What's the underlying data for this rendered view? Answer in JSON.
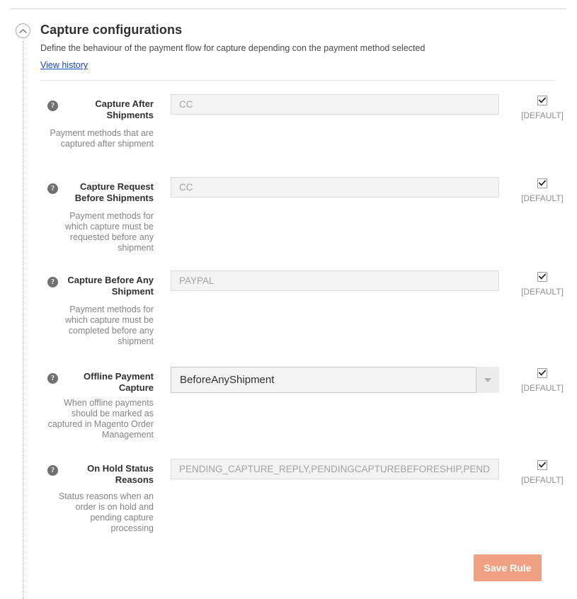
{
  "section": {
    "title": "Capture configurations",
    "description": "Define the behaviour of the payment flow for capture depending con the payment method selected",
    "history_link": "View history",
    "collapse_icon": "chevron-up-circle-icon",
    "help_icon": "question-mark-icon"
  },
  "fields": [
    {
      "label": "Capture After Shipments",
      "note": "Payment methods that are captured after shipment",
      "control": "text",
      "value": "",
      "placeholder": "CC",
      "scope_checked": true,
      "scope_label": "[DEFAULT]"
    },
    {
      "label": "Capture Request Before Shipments",
      "note": "Payment methods for which capture must be requested before any shipment",
      "control": "text",
      "value": "",
      "placeholder": "CC",
      "scope_checked": true,
      "scope_label": "[DEFAULT]"
    },
    {
      "label": "Capture Before Any Shipment",
      "note": "Payment methods for which capture must be completed before any shipment",
      "control": "text",
      "value": "",
      "placeholder": "PAYPAL",
      "scope_checked": true,
      "scope_label": "[DEFAULT]"
    },
    {
      "label": "Offline Payment Capture",
      "note": "When offline payments should be marked as captured in Magento Order Management",
      "control": "select",
      "value": "BeforeAnyShipment",
      "placeholder": "",
      "scope_checked": true,
      "scope_label": "[DEFAULT]"
    },
    {
      "label": "On Hold Status Reasons",
      "note": "Status reasons when an order is on hold and pending capture processing",
      "control": "text",
      "value": "",
      "placeholder": "PENDING_CAPTURE_REPLY,PENDINGCAPTUREBEFORESHIP,PENDINGCAPTUREAFTERSHIP",
      "scope_checked": true,
      "scope_label": "[DEFAULT]"
    }
  ],
  "footer": {
    "save_label": "Save Rule"
  },
  "colors": {
    "link": "#1a44b8",
    "save_button": "#f0a183",
    "input_background": "#f3f3f3",
    "note_text": "#858585"
  },
  "layout": {
    "field_tops": [
      133,
      250,
      382,
      518,
      648
    ],
    "note_tops": [
      181,
      298,
      430,
      562,
      694
    ]
  }
}
